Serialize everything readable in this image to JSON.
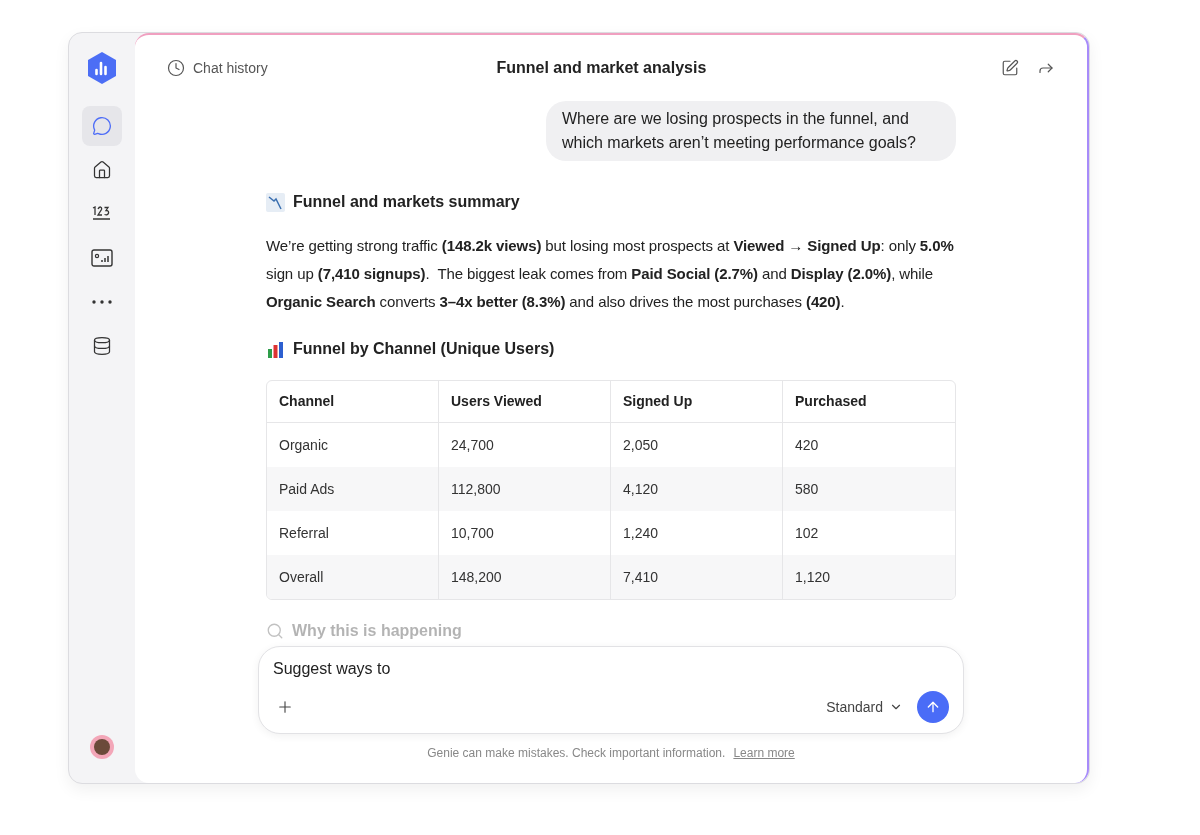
{
  "header": {
    "history_label": "Chat history",
    "title": "Funnel and market analysis"
  },
  "sidebar": {
    "items": [
      {
        "kind": "chat",
        "selected": true
      },
      {
        "kind": "home",
        "selected": false
      },
      {
        "kind": "numbers",
        "selected": false
      },
      {
        "kind": "dashboard",
        "selected": false
      },
      {
        "kind": "more",
        "selected": false
      },
      {
        "kind": "data",
        "selected": false
      }
    ]
  },
  "conversation": {
    "user_message": "Where are we losing prospects in the funnel, and which markets aren’t meeting performance goals?",
    "summary_heading": "Funnel and markets summary",
    "summary": "We’re getting strong traffic **(148.2k views)** but losing most prospects at **Viewed → Signed Up**: only **5.0%** sign up **(7,410 signups)**.  The biggest leak comes from **Paid Social (2.7%)** and **Display (2.0%)**, while **Organic Search** converts **3–4x better (8.3%)** and also drives the most purchases **(420)**.",
    "table_heading": "Funnel by Channel (Unique Users)",
    "table": {
      "columns": [
        "Channel",
        "Users Viewed",
        "Signed Up",
        "Purchased"
      ],
      "rows": [
        [
          "Organic",
          "24,700",
          "2,050",
          "420"
        ],
        [
          "Paid Ads",
          "112,800",
          "4,120",
          "580"
        ],
        [
          "Referral",
          "10,700",
          "1,240",
          "102"
        ],
        [
          "Overall",
          "148,200",
          "7,410",
          "1,120"
        ]
      ]
    },
    "next_heading": "Why this is happening"
  },
  "composer": {
    "value": "Suggest ways to",
    "mode": "Standard"
  },
  "disclaimer": {
    "text": "Genie can make mistakes. Check important information.",
    "link": "Learn more"
  }
}
